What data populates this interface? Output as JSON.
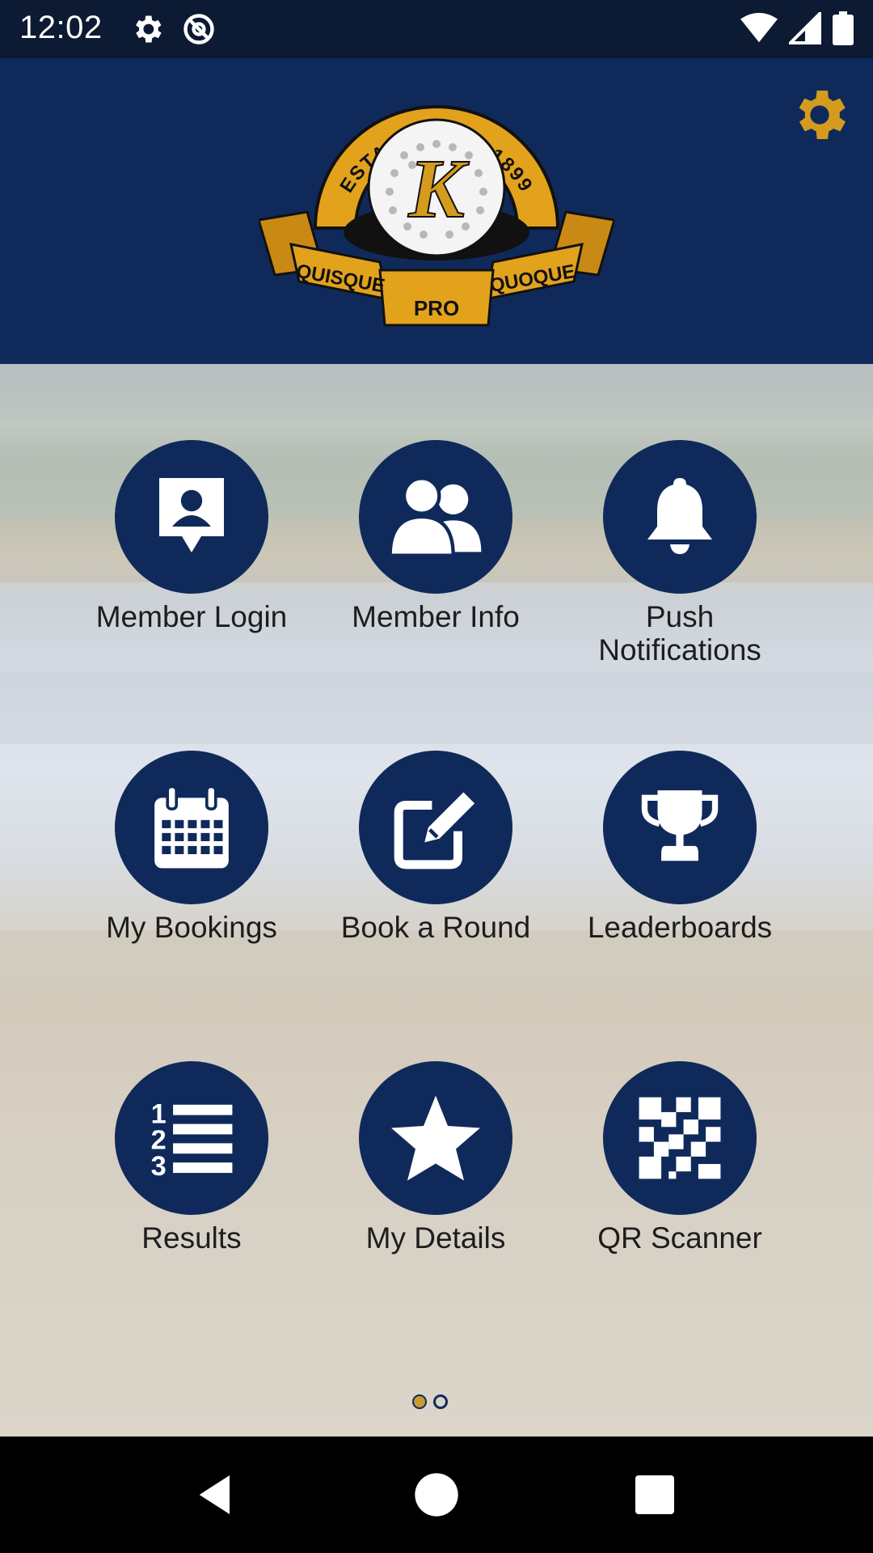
{
  "status_bar": {
    "time": "12:02",
    "left_icons": [
      "gear-icon",
      "at-sign-icon"
    ],
    "right_icons": [
      "wifi-icon",
      "cell-signal-icon",
      "battery-icon"
    ]
  },
  "header": {
    "background_color": "#0f2a5a",
    "accent_color": "#d49b1f",
    "logo": {
      "established": "ESTABLISHED 1899",
      "monogram": "K",
      "motto_left": "QUISQUE",
      "motto_center": "PRO",
      "motto_right": "QUOQUE"
    },
    "settings_icon": "gear-icon"
  },
  "tiles": [
    {
      "label": "Member Login",
      "icon": "member-card-icon"
    },
    {
      "label": "Member Info",
      "icon": "members-icon"
    },
    {
      "label": "Push\nNotifications",
      "icon": "bell-icon"
    },
    {
      "label": "My Bookings",
      "icon": "calendar-icon"
    },
    {
      "label": "Book a Round",
      "icon": "edit-icon"
    },
    {
      "label": "Leaderboards",
      "icon": "trophy-icon"
    },
    {
      "label": "Results",
      "icon": "numbered-list-icon"
    },
    {
      "label": "My Details",
      "icon": "star-icon"
    },
    {
      "label": "QR Scanner",
      "icon": "qr-icon"
    }
  ],
  "pager": {
    "pages": 2,
    "current": 1
  },
  "nav_bar": {
    "buttons": [
      "back-icon",
      "home-icon",
      "recents-icon"
    ]
  }
}
